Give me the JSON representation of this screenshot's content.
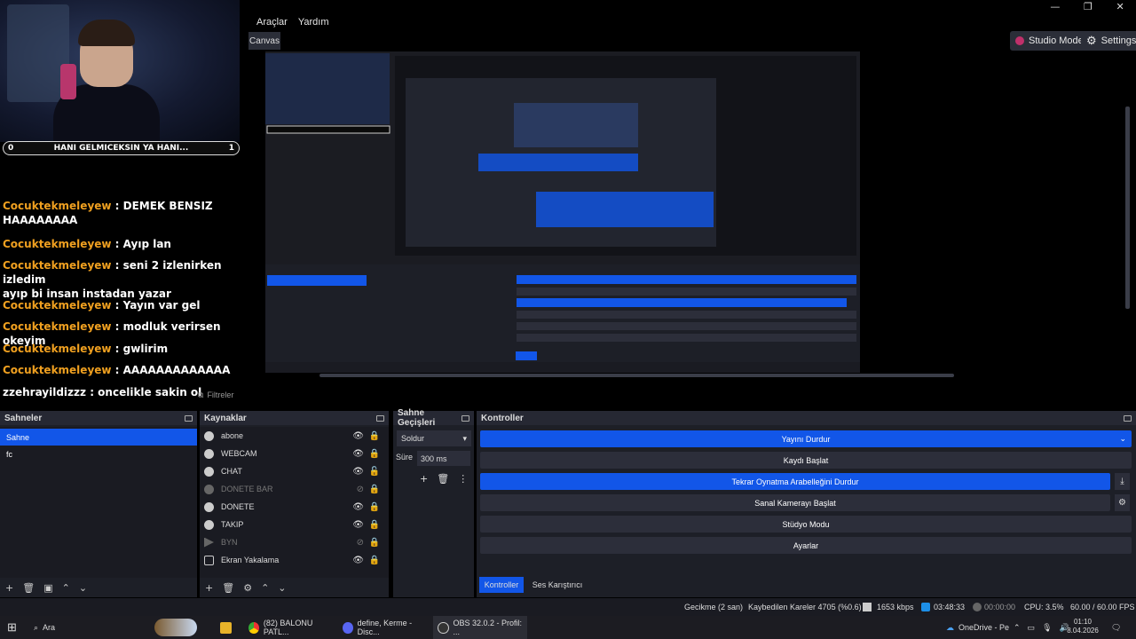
{
  "webcam_banner": {
    "left": "0",
    "title": "HANI GELMICEKSIN YA HANI...",
    "right": "1"
  },
  "chat": [
    {
      "user": "Cocuktekmeleyew",
      "text": ": DEMEK BENSIZ",
      "text2": "HAAAAAAAA"
    },
    {
      "user": "Cocuktekmeleyew",
      "text": ": Ayıp lan"
    },
    {
      "user": "Cocuktekmeleyew",
      "text": ": seni 2 izlenirken izledim",
      "text2": "ayıp bi insan instadan yazar"
    },
    {
      "user": "Cocuktekmeleyew",
      "text": ": Yayın var gel"
    },
    {
      "user": "Cocuktekmeleyew",
      "text": ": modluk verirsen okeyim"
    },
    {
      "user": "Cocuktekmeleyew",
      "text": ": gwlirim"
    },
    {
      "user": "Cocuktekmeleyew",
      "text": ": AAAAAAAAAAAAA"
    },
    {
      "user": "zzehrayildizzz",
      "text": ": oncelikle sakin ol"
    }
  ],
  "menu": {
    "tools": "Araçlar",
    "help": "Yardım"
  },
  "window_controls": {
    "min": "—",
    "max": "❐",
    "close": "✕"
  },
  "canvas_tab": "Canvas",
  "studio_mode": "Studio Mode",
  "settings": "Settings",
  "filters": "Filtreler",
  "scenes": {
    "title": "Sahneler",
    "items": [
      "Sahne",
      "fc"
    ]
  },
  "sources": {
    "title": "Kaynaklar",
    "items": [
      {
        "name": "abone",
        "visible": true
      },
      {
        "name": "WEBCAM",
        "visible": true
      },
      {
        "name": "CHAT",
        "visible": true
      },
      {
        "name": "DONETE BAR",
        "visible": false
      },
      {
        "name": "DONETE",
        "visible": true
      },
      {
        "name": "TAKIP",
        "visible": true
      },
      {
        "name": "BYN",
        "visible": false
      },
      {
        "name": "Ekran Yakalama",
        "visible": true
      }
    ]
  },
  "transitions": {
    "title": "Sahne Geçişleri",
    "type": "Soldur",
    "duration_label": "Süre",
    "duration": "300 ms"
  },
  "controls": {
    "title": "Kontroller",
    "stream": "Yayını Durdur",
    "record": "Kaydı Başlat",
    "replay": "Tekrar Oynatma Arabelleğini Durdur",
    "vcam": "Sanal Kamerayı Başlat",
    "studio": "Stüdyo Modu",
    "settings": "Ayarlar"
  },
  "bottom_tabs": {
    "controls": "Kontroller",
    "mixer": "Ses Karıştırıcı"
  },
  "status": {
    "delay": "Gecikme (2 san)",
    "dropped": "Kaybedilen Kareler 4705 (%0.6)",
    "bitrate": "1653 kbps",
    "stream_time": "03:48:33",
    "rec_time": "00:00:00",
    "cpu": "CPU: 3.5%",
    "fps": "60.00 / 60.00 FPS"
  },
  "taskbar": {
    "search": "Ara",
    "apps": [
      "(82) BALONU PATL...",
      "define, Kerme - Disc...",
      "OBS 32.0.2 - Profil: ..."
    ],
    "onedrive": "OneDrive - Pe",
    "time": "01:10",
    "date": "8.04.2026"
  },
  "colors": {
    "accent": "#1256e8",
    "chat_user": "#f0a020",
    "panel": "#1d1f27"
  }
}
